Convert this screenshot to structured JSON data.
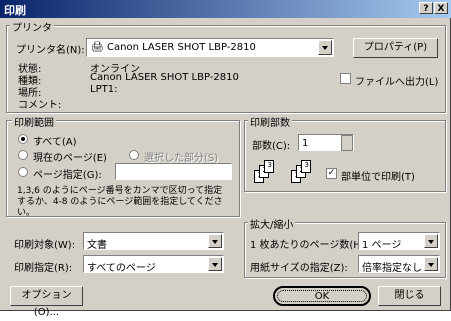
{
  "window": {
    "title": "印刷",
    "help_btn": "?",
    "close_btn": "X"
  },
  "printer": {
    "group": "プリンタ",
    "name_label": "プリンタ名(N):",
    "name_value": "Canon LASER SHOT LBP-2810",
    "properties_btn": "プロパティ(P)",
    "status_label": "状態:",
    "status_value": "オンライン",
    "type_label": "種類:",
    "type_value": "Canon LASER SHOT LBP-2810",
    "where_label": "場所:",
    "where_value": "LPT1:",
    "comment_label": "コメント:",
    "print_to_file": "ファイルへ出力(L)"
  },
  "range": {
    "group": "印刷範囲",
    "all": "すべて(A)",
    "current": "現在のページ(E)",
    "selection": "選択した部分(S)",
    "pages": "ページ指定(G):",
    "pages_value": "",
    "help": "1,3,6 のようにページ番号をカンマで区切って指定するか、4-8 のようにページ範囲を指定してください。"
  },
  "copies": {
    "group": "印刷部数",
    "count_label": "部数(C):",
    "count_value": "1",
    "collate": "部単位で印刷(T)"
  },
  "zoom": {
    "group": "拡大/縮小",
    "pps_label": "1 枚あたりのページ数(H):",
    "pps_value": "1 ページ",
    "paper_label": "用紙サイズの指定(Z):",
    "paper_value": "倍率指定なし"
  },
  "what": {
    "print_what_label": "印刷対象(W):",
    "print_what_value": "文書",
    "print_label": "印刷指定(R):",
    "print_value": "すべてのページ"
  },
  "buttons": {
    "options": "オプション(O)...",
    "ok": "OK",
    "close": "閉じる"
  }
}
